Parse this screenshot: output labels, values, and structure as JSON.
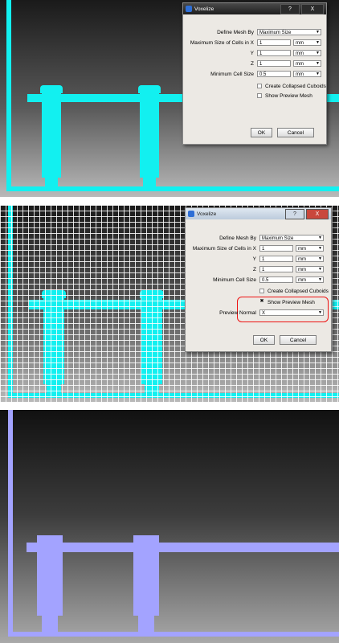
{
  "dialog_title": "Voxelize",
  "titlebar_buttons": {
    "help": "?",
    "close": "X"
  },
  "labels": {
    "define_mesh_by": "Define Mesh By",
    "max_size_x": "Maximum Size of Cells in X",
    "y": "Y",
    "z": "Z",
    "min_cell_size": "Minimum Cell Size",
    "create_collapsed": "Create Collapsed Cuboids",
    "show_preview": "Show Preview Mesh",
    "preview_normal": "Preview Normal"
  },
  "values": {
    "define_mesh_by": "Maximum Size",
    "x": "1",
    "y": "1",
    "z": "1",
    "min_cell": "0.5",
    "unit": "mm",
    "preview_normal": "X"
  },
  "panel1": {
    "show_preview_checked": false
  },
  "panel2": {
    "show_preview_checked": true,
    "check_mark": "✖"
  },
  "buttons": {
    "ok": "OK",
    "cancel": "Cancel"
  },
  "colors": {
    "mesh_cyan": "#12f0f0",
    "voxel_lavender": "#a3a3ff",
    "highlight": "#ee1111"
  },
  "icons": {
    "dialog": "voxelize-app-icon",
    "dropdown": "chevron-down-icon"
  }
}
